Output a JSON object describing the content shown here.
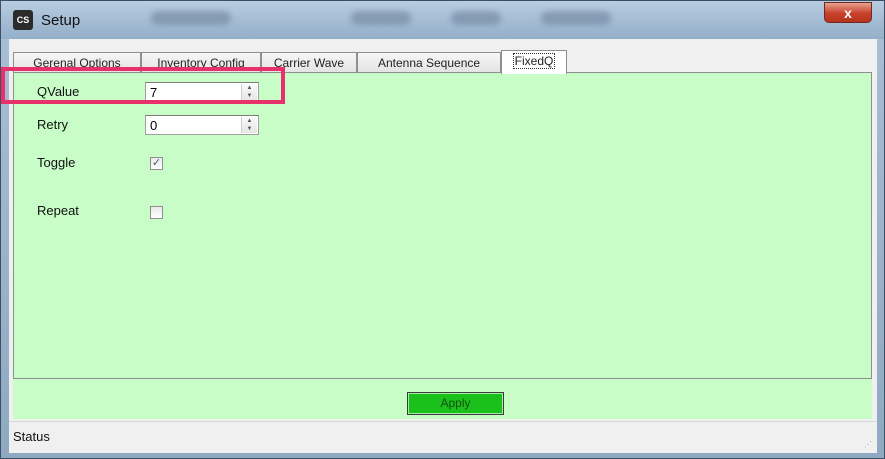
{
  "window": {
    "title": "Setup",
    "icon": "app-logo-icon",
    "close_glyph": "x"
  },
  "tabs": [
    {
      "label": "Gerenal Options"
    },
    {
      "label": "Inventory Config"
    },
    {
      "label": "Carrier Wave"
    },
    {
      "label": "Antenna Sequence"
    },
    {
      "label": "FixedQ"
    }
  ],
  "active_tab": "FixedQ",
  "form": {
    "qvalue": {
      "label": "QValue",
      "value": "7"
    },
    "retry": {
      "label": "Retry",
      "value": "0"
    },
    "toggle": {
      "label": "Toggle",
      "checked": true
    },
    "repeat": {
      "label": "Repeat",
      "checked": false
    }
  },
  "apply_label": "Apply",
  "status_text": "Status",
  "colors": {
    "panel_bg": "#c8fdc8",
    "apply_bg": "#1bc11b",
    "highlight": "#e8306a"
  }
}
